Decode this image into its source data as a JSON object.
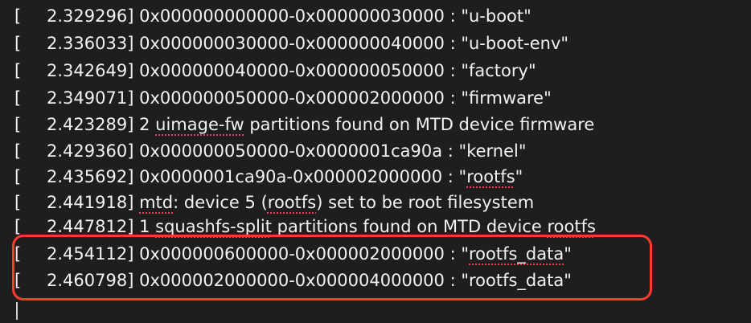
{
  "terminal": {
    "lines": [
      {
        "bracket": "[",
        "ts": "2.329296]",
        "msg_parts": [
          "0x000000000000-0x000000030000 : \"u-boot\""
        ]
      },
      {
        "bracket": "[",
        "ts": "2.336033]",
        "msg_parts": [
          "0x000000030000-0x000000040000 : \"u-boot-env\""
        ]
      },
      {
        "bracket": "[",
        "ts": "2.342649]",
        "msg_parts": [
          "0x000000040000-0x000000050000 : \"factory\""
        ]
      },
      {
        "bracket": "[",
        "ts": "2.349071]",
        "msg_parts": [
          "0x000000050000-0x000002000000 : \"firmware\""
        ]
      },
      {
        "bracket": "[",
        "ts": "2.423289]",
        "msg_parts": [
          "2 ",
          "uimage-fw",
          " partitions found on MTD device firmware"
        ]
      },
      {
        "bracket": "[",
        "ts": "2.429360]",
        "msg_parts": [
          "0x000000050000-0x0000001ca90a : \"kernel\""
        ]
      },
      {
        "bracket": "[",
        "ts": "2.435692]",
        "msg_parts": [
          "0x0000001ca90a-0x000002000000 : \"",
          "rootfs",
          "\""
        ]
      },
      {
        "bracket": "[",
        "ts": "2.441918]",
        "msg_parts": [
          "mtd",
          ": device 5 (",
          "rootfs",
          ") set to be root filesystem"
        ]
      },
      {
        "bracket": "[",
        "ts": "2.447812]",
        "msg_parts": [
          "1 ",
          "squashfs-split",
          " partitions found on MTD device ",
          "rootfs"
        ]
      },
      {
        "bracket": "[",
        "ts": "2.454112]",
        "msg_parts": [
          "0x000000600000-0x000002000000 : \"",
          "rootfs_data",
          "\""
        ]
      },
      {
        "bracket": "[",
        "ts": "2.460798]",
        "msg_parts": [
          "0x000002000000-0x000004000000 : \"rootfs_data\""
        ]
      }
    ]
  },
  "colors": {
    "background": "#1e1e1e",
    "text": "#f2f2f2",
    "highlight_border": "#ff3b2f",
    "spellcheck_underline": "#e0445f"
  }
}
